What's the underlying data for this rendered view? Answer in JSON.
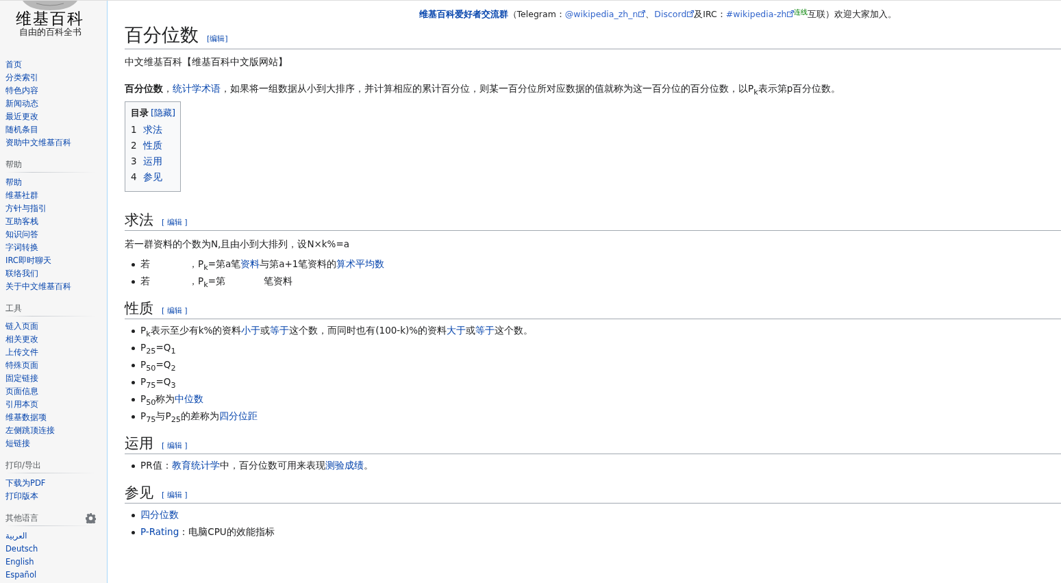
{
  "logo": {
    "title": "维基百科",
    "tagline": "自由的百科全书"
  },
  "sidebar": [
    {
      "items": [
        "首页",
        "分类索引",
        "特色内容",
        "新闻动态",
        "最近更改",
        "随机条目",
        "资助中文维基百科"
      ]
    },
    {
      "heading": "帮助",
      "items": [
        "帮助",
        "维基社群",
        "方针与指引",
        "互助客栈",
        "知识问答",
        "字词转换",
        "IRC即时聊天",
        "联络我们",
        "关于中文维基百科"
      ]
    },
    {
      "heading": "工具",
      "items": [
        "链入页面",
        "相关更改",
        "上传文件",
        "特殊页面",
        "固定链接",
        "页面信息",
        "引用本页",
        "维基数据项",
        "左侧跳顶连接",
        "短链接"
      ]
    },
    {
      "heading": "打印/导出",
      "items": [
        "下载为PDF",
        "打印版本"
      ]
    },
    {
      "heading": "其他语言",
      "settings": true,
      "items": [
        "العربية",
        "Deutsch",
        "English",
        "Español"
      ]
    }
  ],
  "notice": [
    {
      "kind": "boldlink",
      "text": "维基百科爱好者交流群"
    },
    {
      "kind": "text",
      "text": "（Telegram："
    },
    {
      "kind": "extlink",
      "text": "@wikipedia_zh_n"
    },
    {
      "kind": "text",
      "text": "、"
    },
    {
      "kind": "extlink",
      "text": "Discord"
    },
    {
      "kind": "text",
      "text": "及IRC："
    },
    {
      "kind": "extlink",
      "text": "#wikipedia-zh"
    },
    {
      "kind": "note",
      "text": "连线"
    },
    {
      "kind": "text",
      "text": "互联）欢迎大家加入。"
    }
  ],
  "title": "百分位数",
  "title_edit": "[编辑]",
  "subtitle": "中文维基百科【维基百科中文版网站】",
  "intro": [
    {
      "kind": "bold",
      "text": "百分位数"
    },
    {
      "kind": "text",
      "text": "，"
    },
    {
      "kind": "link",
      "text": "统计学术语"
    },
    {
      "kind": "text",
      "text": "，如果将一组数据从小到大排序，并计算相应的累计百分位，则某一百分位所对应数据的值就称为这一百分位的百分位数，以P$_{k}$表示第p百分位数。"
    }
  ],
  "toc": {
    "heading": "目录",
    "toggle": "[隐藏]",
    "items": [
      {
        "number": "1",
        "label": "求法"
      },
      {
        "number": "2",
        "label": "性质"
      },
      {
        "number": "3",
        "label": "运用"
      },
      {
        "number": "4",
        "label": "参见"
      }
    ]
  },
  "sections": [
    {
      "heading": "求法",
      "edit": "[ 编辑 ]",
      "paragraphs": [
        [
          {
            "kind": "text",
            "text": "若一群资料的个数为N,且由小到大排列，设N×k%=a"
          }
        ]
      ],
      "bullets": [
        [
          {
            "kind": "text",
            "text": "若"
          },
          {
            "kind": "gap"
          },
          {
            "kind": "text",
            "text": "，P$_{k}$=第a笔"
          },
          {
            "kind": "link",
            "text": "资料"
          },
          {
            "kind": "text",
            "text": "与第a+1笔资料的"
          },
          {
            "kind": "link",
            "text": "算术平均数"
          }
        ],
        [
          {
            "kind": "text",
            "text": "若"
          },
          {
            "kind": "gap"
          },
          {
            "kind": "text",
            "text": "，P$_{k}$=第"
          },
          {
            "kind": "gap"
          },
          {
            "kind": "text",
            "text": "笔资料"
          }
        ]
      ]
    },
    {
      "heading": "性质",
      "edit": "[ 编辑 ]",
      "bullets": [
        [
          {
            "kind": "text",
            "text": "P$_{k}$表示至少有k%的资料"
          },
          {
            "kind": "link",
            "text": "小于"
          },
          {
            "kind": "text",
            "text": "或"
          },
          {
            "kind": "link",
            "text": "等于"
          },
          {
            "kind": "text",
            "text": "这个数，而同时也有(100-k)%的资料"
          },
          {
            "kind": "link",
            "text": "大于"
          },
          {
            "kind": "text",
            "text": "或"
          },
          {
            "kind": "link",
            "text": "等于"
          },
          {
            "kind": "text",
            "text": "这个数。"
          }
        ],
        [
          {
            "kind": "text",
            "text": "P$_{25}$=Q$_{1}$"
          }
        ],
        [
          {
            "kind": "text",
            "text": "P$_{50}$=Q$_{2}$"
          }
        ],
        [
          {
            "kind": "text",
            "text": "P$_{75}$=Q$_{3}$"
          }
        ],
        [
          {
            "kind": "text",
            "text": "P$_{50}$称为"
          },
          {
            "kind": "link",
            "text": "中位数"
          }
        ],
        [
          {
            "kind": "text",
            "text": "P$_{75}$与P$_{25}$的差称为"
          },
          {
            "kind": "link",
            "text": "四分位距"
          }
        ]
      ]
    },
    {
      "heading": "运用",
      "edit": "[ 编辑 ]",
      "bullets": [
        [
          {
            "kind": "text",
            "text": "PR值："
          },
          {
            "kind": "link",
            "text": "教育统计学"
          },
          {
            "kind": "text",
            "text": "中，百分位数可用来表现"
          },
          {
            "kind": "link",
            "text": "测验成绩"
          },
          {
            "kind": "text",
            "text": "。"
          }
        ]
      ]
    },
    {
      "heading": "参见",
      "edit": "[ 编辑 ]",
      "bullets": [
        [
          {
            "kind": "link",
            "text": "四分位数"
          }
        ],
        [
          {
            "kind": "link",
            "text": "P-Rating"
          },
          {
            "kind": "text",
            "text": "：电脑CPU的效能指标"
          }
        ]
      ]
    }
  ]
}
